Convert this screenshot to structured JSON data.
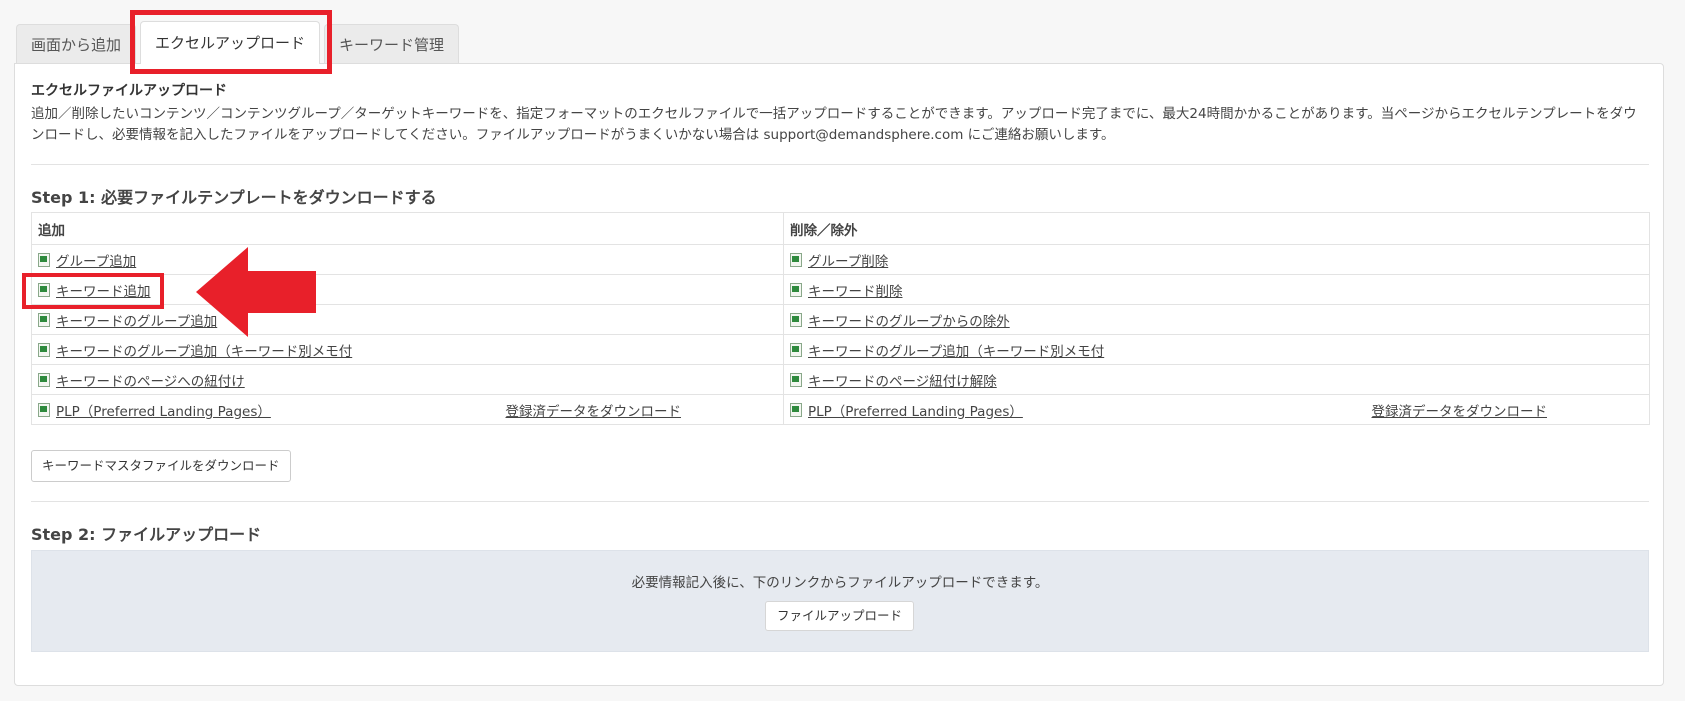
{
  "tabs": [
    {
      "label": "画面から追加",
      "active": false
    },
    {
      "label": "エクセルアップロード",
      "active": true
    },
    {
      "label": "キーワード管理",
      "active": false
    }
  ],
  "section": {
    "title": "エクセルファイルアップロード",
    "description": "追加／削除したいコンテンツ／コンテンツグループ／ターゲットキーワードを、指定フォーマットのエクセルファイルで一括アップロードすることができます。アップロード完了までに、最大24時間かかることがあります。当ページからエクセルテンプレートをダウンロードし、必要情報を記入したファイルをアップロードしてください。ファイルアップロードがうまくいかない場合は support@demandsphere.com にご連絡お願いします。"
  },
  "step1": {
    "title": "Step 1: 必要ファイルテンプレートをダウンロードする",
    "add_header": "追加",
    "remove_header": "削除／除外",
    "rows": [
      {
        "add": "グループ追加",
        "remove": "グループ削除"
      },
      {
        "add": "キーワード追加",
        "remove": "キーワード削除"
      },
      {
        "add": "キーワードのグループ追加",
        "remove": "キーワードのグループからの除外"
      },
      {
        "add": "キーワードのグループ追加（キーワード別メモ付",
        "remove": "キーワードのグループ追加（キーワード別メモ付"
      },
      {
        "add": "キーワードのページへの紐付け",
        "remove": "キーワードのページ紐付け解除"
      },
      {
        "add": "PLP（Preferred Landing Pages）",
        "remove": "PLP（Preferred Landing Pages）",
        "add_extra": "登録済データをダウンロード",
        "remove_extra": "登録済データをダウンロード"
      }
    ],
    "master_button": "キーワードマスタファイルをダウンロード"
  },
  "step2": {
    "title": "Step 2: ファイルアップロード",
    "instruction": "必要情報記入後に、下のリンクからファイルアップロードできます。",
    "upload_button": "ファイルアップロード"
  },
  "colors": {
    "highlight": "#e8202a",
    "upload_box_bg": "#e6eaf0"
  }
}
